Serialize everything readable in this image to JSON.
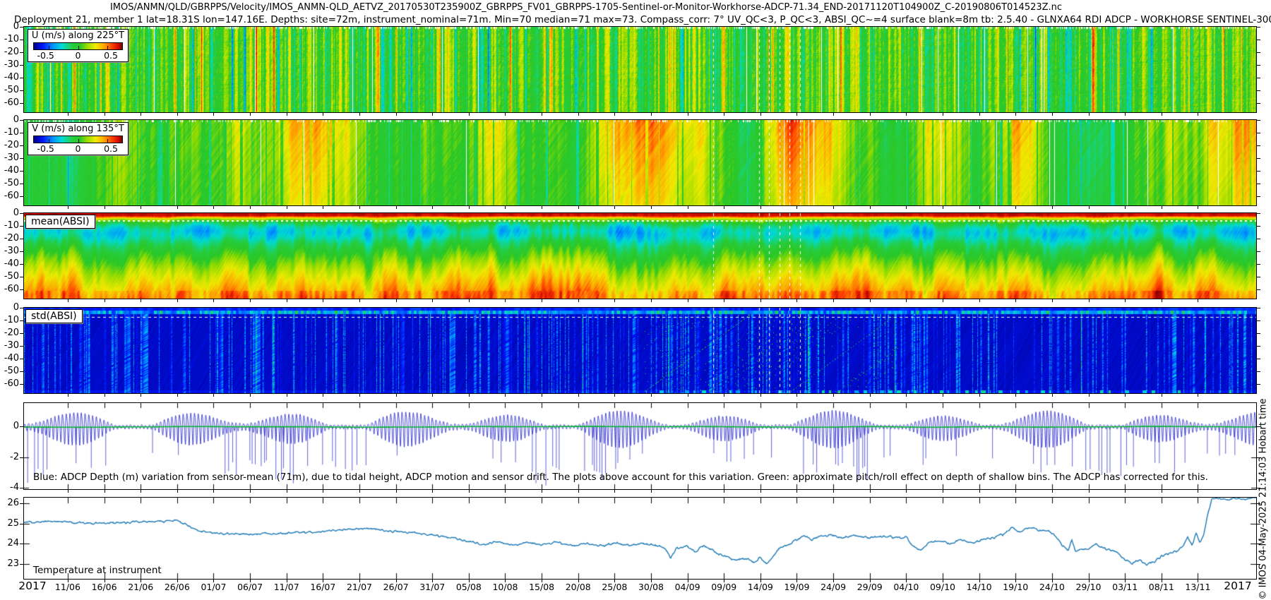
{
  "header": {
    "line1": "IMOS/ANMN/QLD/GBRPPS/Velocity/IMOS_ANMN-QLD_AETVZ_20170530T235900Z_GBRPPS_FV01_GBRPPS-1705-Sentinel-or-Monitor-Workhorse-ADCP-71.34_END-20171120T104900Z_C-20190806T014523Z.nc",
    "line2": "Deployment 21, member 1 lat=18.31S lon=147.16E. Depths: site=72m, instrument_nominal=71m. Min=70 median=71 max=73. Compass_corr: 7° UV_QC<3, P_QC<3, ABSI_QC~=4 surface blank=8m tb: 2.5.40 - GLNXA64 RDI ADCP - WORKHORSE SENTINEL-300"
  },
  "panels": {
    "u": {
      "legend_title": "U (m/s) along 225°T",
      "legend_ticks": [
        "-0.5",
        "0",
        "0.5"
      ],
      "y_ticks": [
        0,
        -10,
        -20,
        -30,
        -40,
        -50,
        -60
      ]
    },
    "v": {
      "legend_title": "V (m/s) along 135°T",
      "legend_ticks": [
        "-0.5",
        "0",
        "0.5"
      ],
      "y_ticks": [
        0,
        -10,
        -20,
        -30,
        -40,
        -50,
        -60
      ]
    },
    "mean_absi": {
      "label": "mean(ABSI)",
      "y_ticks": [
        0,
        -10,
        -20,
        -30,
        -40,
        -50,
        -60
      ]
    },
    "std_absi": {
      "label": "std(ABSI)",
      "y_ticks": [
        0,
        -10,
        -20,
        -30,
        -40,
        -50,
        -60
      ]
    },
    "depth": {
      "y_ticks": [
        0,
        -2,
        -4
      ],
      "caption": "Blue: ADCP Depth (m) variation from sensor-mean (71m), due to tidal height, ADCP motion and sensor drift. The plots above account for this variation. Green: approximate pitch/roll effect on depth of shallow bins. The ADCP has corrected for this."
    },
    "temperature": {
      "label": "Temperature at instrument",
      "y_ticks": [
        26,
        25,
        24,
        23
      ]
    }
  },
  "x_axis": {
    "year_left": "2017",
    "year_right": "2017",
    "ticks": [
      "11/06",
      "16/06",
      "21/06",
      "26/06",
      "01/07",
      "06/07",
      "11/07",
      "16/07",
      "21/07",
      "26/07",
      "31/07",
      "05/08",
      "10/08",
      "15/08",
      "20/08",
      "25/08",
      "30/08",
      "04/09",
      "09/09",
      "14/09",
      "19/09",
      "24/09",
      "29/09",
      "04/10",
      "09/10",
      "14/10",
      "19/10",
      "24/10",
      "29/10",
      "03/11",
      "08/11",
      "13/11"
    ]
  },
  "copyright": "© IMOS 04-May-2025 21:14:03 Hobart time",
  "chart_data": [
    {
      "id": "u_velocity",
      "type": "heatmap",
      "title": "U (m/s) along 225°T",
      "colormap": "jet",
      "value_range": [
        -0.75,
        0.75
      ],
      "colorbar_ticks": [
        -0.5,
        0,
        0.5
      ],
      "ylim": [
        -67,
        0
      ],
      "time_range": [
        "2017-06-05",
        "2017-11-21"
      ],
      "summary": "Cross-shore velocity component; values mostly -0.2 to 0.2 m/s (green) with high-frequency full-depth vertical striping to ±0.5 m/s and scattered thin white missing-data columns"
    },
    {
      "id": "v_velocity",
      "type": "heatmap",
      "title": "V (m/s) along 135°T",
      "colormap": "jet",
      "value_range": [
        -0.75,
        0.75
      ],
      "colorbar_ticks": [
        -0.5,
        0,
        0.5
      ],
      "ylim": [
        -67,
        0
      ],
      "time_range": [
        "2017-06-05",
        "2017-11-21"
      ],
      "baseline_day_value": [
        [
          0,
          0.02
        ],
        [
          6,
          -0.1
        ],
        [
          10,
          0.05
        ],
        [
          15,
          0.1
        ],
        [
          20,
          0.08
        ],
        [
          25,
          0.12
        ],
        [
          29,
          0.3
        ],
        [
          32,
          0.15
        ],
        [
          36,
          0.35
        ],
        [
          40,
          0.48
        ],
        [
          43,
          0.32
        ],
        [
          46,
          0.15
        ],
        [
          50,
          0.02
        ],
        [
          55,
          0.08
        ],
        [
          60,
          0.05
        ],
        [
          63,
          0.28
        ],
        [
          66,
          0.18
        ],
        [
          69,
          -0.02
        ],
        [
          73,
          0.05
        ],
        [
          77,
          0.15
        ],
        [
          80,
          0.35
        ],
        [
          84,
          0.52
        ],
        [
          88,
          0.45
        ],
        [
          91,
          0.3
        ],
        [
          94,
          0.18
        ],
        [
          97,
          -0.08
        ],
        [
          99,
          -0.18
        ],
        [
          101,
          0.05
        ],
        [
          103,
          0.35
        ],
        [
          106,
          0.5
        ],
        [
          109,
          0.42
        ],
        [
          112,
          0.3
        ],
        [
          115,
          0.15
        ],
        [
          118,
          0.02
        ],
        [
          121,
          0.08
        ],
        [
          124,
          0.28
        ],
        [
          126,
          0.35
        ],
        [
          128,
          0.15
        ],
        [
          131,
          0.02
        ],
        [
          134,
          0.22
        ],
        [
          136,
          0.42
        ],
        [
          138,
          0.25
        ],
        [
          140,
          0.1
        ],
        [
          143,
          0
        ],
        [
          146,
          -0.12
        ],
        [
          149,
          0.02
        ],
        [
          152,
          -0.05
        ],
        [
          155,
          0.08
        ],
        [
          157,
          0.22
        ],
        [
          159,
          0.1
        ],
        [
          161,
          0.2
        ],
        [
          163,
          0.35
        ],
        [
          165,
          0.2
        ],
        [
          167,
          0.42
        ],
        [
          169,
          0.5
        ]
      ]
    },
    {
      "id": "mean_absi",
      "type": "heatmap",
      "label": "mean(ABSI)",
      "colormap": "jet",
      "ylim": [
        -67,
        0
      ],
      "time_range": [
        "2017-06-05",
        "2017-11-21"
      ],
      "depth_profile_cmapfrac": [
        [
          0,
          0.97
        ],
        [
          1.8,
          0.94
        ],
        [
          2.6,
          0.86
        ],
        [
          3.4,
          0.72
        ],
        [
          4.5,
          0.62
        ],
        [
          6,
          0.52
        ],
        [
          8,
          0.42
        ],
        [
          11,
          0.34
        ],
        [
          15,
          0.3
        ],
        [
          19,
          0.34
        ],
        [
          24,
          0.42
        ],
        [
          30,
          0.49
        ],
        [
          36,
          0.55
        ],
        [
          42,
          0.61
        ],
        [
          48,
          0.66
        ],
        [
          54,
          0.71
        ],
        [
          59,
          0.75
        ],
        [
          63,
          0.78
        ],
        [
          67,
          0.82
        ]
      ],
      "summary": "Mean acoustic backscatter: dark-red band at surface, cyan/blue minimum near 10-20 m, green mid-column, yellow-orange-red increasing toward bottom"
    },
    {
      "id": "std_absi",
      "type": "heatmap",
      "label": "std(ABSI)",
      "colormap": "jet",
      "ylim": [
        -67,
        0
      ],
      "time_range": [
        "2017-06-05",
        "2017-11-21"
      ],
      "summary": "Std of backscatter: dark navy background, lighter-blue band and cyan dashes in top ~5 m, sparse vertical light-blue streaks, scattered green specks Sep-Oct"
    },
    {
      "id": "adcp_depth_variation",
      "type": "line",
      "ylim": [
        -4.2,
        1.6
      ],
      "y_ticks": [
        0,
        -2,
        -4
      ],
      "series": [
        {
          "name": "ADCP depth variation from sensor-mean (m)",
          "color": "#2828d2"
        },
        {
          "name": "approximate pitch/roll effect on shallow bins",
          "color": "#00b32c"
        }
      ],
      "tide": {
        "semidiurnal_period_days": 0.5175,
        "spring_neap_period_days": 14.77,
        "amplitude_m": [
          0.12,
          1.5
        ],
        "downward_spike_depth_m": [
          -1.8,
          -3.9
        ]
      }
    },
    {
      "id": "temperature",
      "type": "line",
      "label": "Temperature at instrument",
      "color": "#1b78b5",
      "ylim": [
        22.25,
        26.28
      ],
      "y_ticks": [
        26,
        25,
        24,
        23
      ],
      "keypoints_day_degC": [
        [
          0,
          25.05
        ],
        [
          4,
          25.1
        ],
        [
          9,
          25.0
        ],
        [
          14,
          25.05
        ],
        [
          19,
          25.1
        ],
        [
          21,
          25.15
        ],
        [
          22.5,
          24.9
        ],
        [
          24,
          24.62
        ],
        [
          27,
          24.5
        ],
        [
          31,
          24.48
        ],
        [
          35,
          24.5
        ],
        [
          38,
          24.55
        ],
        [
          41,
          24.6
        ],
        [
          44,
          24.68
        ],
        [
          47,
          24.75
        ],
        [
          50,
          24.62
        ],
        [
          53,
          24.55
        ],
        [
          56,
          24.42
        ],
        [
          59,
          24.28
        ],
        [
          61,
          24.1
        ],
        [
          63,
          23.95
        ],
        [
          65,
          24.12
        ],
        [
          67,
          23.9
        ],
        [
          69,
          24.05
        ],
        [
          71,
          23.93
        ],
        [
          73,
          24.08
        ],
        [
          75,
          23.9
        ],
        [
          77,
          24.0
        ],
        [
          79,
          23.88
        ],
        [
          81,
          24.02
        ],
        [
          83,
          23.92
        ],
        [
          85,
          24.0
        ],
        [
          87,
          23.9
        ],
        [
          88,
          23.72
        ],
        [
          88.7,
          23.3
        ],
        [
          89.5,
          23.78
        ],
        [
          91,
          23.85
        ],
        [
          92,
          23.58
        ],
        [
          93,
          23.88
        ],
        [
          94.5,
          23.65
        ],
        [
          96,
          23.38
        ],
        [
          97.5,
          23.18
        ],
        [
          99,
          23.28
        ],
        [
          100,
          23.05
        ],
        [
          101,
          23.3
        ],
        [
          101.8,
          22.98
        ],
        [
          102.6,
          23.3
        ],
        [
          103.5,
          23.75
        ],
        [
          105,
          23.95
        ],
        [
          106,
          24.2
        ],
        [
          107,
          24.42
        ],
        [
          108,
          24.18
        ],
        [
          109,
          24.32
        ],
        [
          110.5,
          24.42
        ],
        [
          112,
          24.3
        ],
        [
          114,
          24.4
        ],
        [
          116,
          24.3
        ],
        [
          118,
          24.38
        ],
        [
          120,
          24.28
        ],
        [
          121,
          24.32
        ],
        [
          122,
          23.82
        ],
        [
          123,
          23.68
        ],
        [
          124,
          24.02
        ],
        [
          125.5,
          24.15
        ],
        [
          127,
          24.0
        ],
        [
          128.5,
          24.18
        ],
        [
          130,
          24.05
        ],
        [
          131.5,
          24.2
        ],
        [
          133,
          24.28
        ],
        [
          134.5,
          24.5
        ],
        [
          135.5,
          24.78
        ],
        [
          136.5,
          24.55
        ],
        [
          137.5,
          24.72
        ],
        [
          138.5,
          24.78
        ],
        [
          139.5,
          24.62
        ],
        [
          140.5,
          24.68
        ],
        [
          141.5,
          24.35
        ],
        [
          142.5,
          23.88
        ],
        [
          143.2,
          23.62
        ],
        [
          143.7,
          24.25
        ],
        [
          144.2,
          23.6
        ],
        [
          145,
          23.68
        ],
        [
          146,
          23.75
        ],
        [
          147,
          24.0
        ],
        [
          148,
          23.76
        ],
        [
          149,
          23.7
        ],
        [
          150,
          23.52
        ],
        [
          151,
          23.22
        ],
        [
          152,
          23.02
        ],
        [
          153,
          23.18
        ],
        [
          154,
          22.96
        ],
        [
          155,
          23.1
        ],
        [
          156,
          23.35
        ],
        [
          157,
          23.52
        ],
        [
          158,
          23.62
        ],
        [
          159,
          23.85
        ],
        [
          159.6,
          24.3
        ],
        [
          160.2,
          23.92
        ],
        [
          160.8,
          24.52
        ],
        [
          161.3,
          24.05
        ],
        [
          161.8,
          24.4
        ],
        [
          162.3,
          25.4
        ],
        [
          162.9,
          26.18
        ],
        [
          164,
          26.25
        ],
        [
          165,
          26.15
        ],
        [
          166,
          26.28
        ],
        [
          167,
          26.18
        ],
        [
          168,
          26.26
        ],
        [
          169,
          26.3
        ],
        [
          170,
          26.22
        ]
      ]
    }
  ]
}
